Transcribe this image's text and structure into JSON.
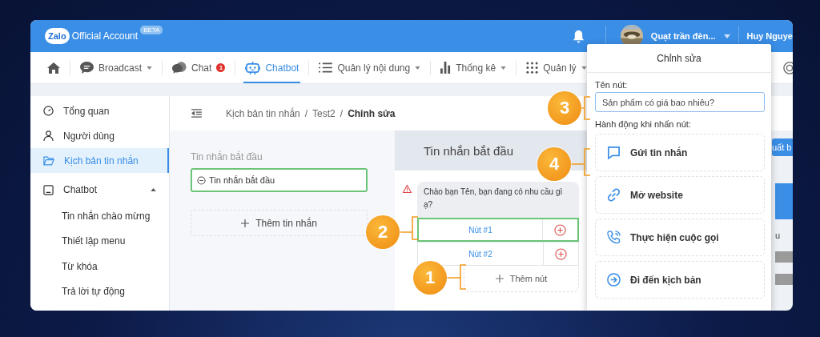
{
  "header": {
    "logo": "Zalo",
    "brand": "Official Account",
    "badge": "BETA",
    "page_name": "Quạt trần đèn...",
    "user_name": "Huy Nguye"
  },
  "nav": [
    {
      "kind": "home",
      "selected": false,
      "dropdown": false
    },
    {
      "kind": "broadcast",
      "label": "Broadcast",
      "selected": false,
      "dropdown": true
    },
    {
      "kind": "chat",
      "label": "Chat",
      "count": "1",
      "selected": false,
      "dropdown": false
    },
    {
      "kind": "chatbot",
      "label": "Chatbot",
      "selected": true,
      "dropdown": false
    },
    {
      "kind": "content",
      "label": "Quản lý nội dung",
      "selected": false,
      "dropdown": true
    },
    {
      "kind": "stats",
      "label": "Thống kê",
      "selected": false,
      "dropdown": true
    },
    {
      "kind": "manage",
      "label": "Quản lý",
      "selected": false,
      "dropdown": true
    }
  ],
  "sidebar": [
    {
      "kind": "gauge",
      "label": "Tổng quan",
      "selected": false
    },
    {
      "kind": "user",
      "label": "Người dùng",
      "selected": false
    },
    {
      "kind": "folder",
      "label": "Kịch bản tin nhắn",
      "selected": true
    },
    {
      "kind": "bot",
      "label": "Chatbot",
      "selected": false,
      "expanded": true,
      "children": [
        {
          "label": "Tin nhắn chào mừng",
          "selected": false
        },
        {
          "label": "Thiết lập menu",
          "selected": false
        },
        {
          "label": "Từ khóa",
          "selected": false
        },
        {
          "label": "Trả lời tự động",
          "selected": false
        }
      ]
    }
  ],
  "breadcrumb": [
    {
      "kind": "link",
      "label": "Kịch bản tin nhắn"
    },
    {
      "kind": "separator",
      "label": "/"
    },
    {
      "kind": "link",
      "label": "Test2"
    },
    {
      "kind": "separator",
      "label": "/"
    },
    {
      "kind": "current",
      "label": "Chỉnh sửa"
    }
  ],
  "messages": {
    "title": "Tin nhắn bắt đầu",
    "items": [
      {
        "label": "Tin nhắn bắt đầu",
        "selected": true
      }
    ],
    "add_button": "Thêm tin nhắn"
  },
  "preview": {
    "title": "Tin nhắn bắt đầu",
    "warning": true,
    "text": "Chào bạn Tên, bạn đang có nhu cầu gì ạ?",
    "buttons": [
      {
        "label": "Nút #1",
        "selected": true
      },
      {
        "label": "Nút #2",
        "selected": false
      }
    ],
    "add_button": "Thêm nút"
  },
  "side_strip": {
    "button": "uất b",
    "text": "u"
  },
  "editor": {
    "title": "Chỉnh sửa",
    "name_label": "Tên nút:",
    "name_value": "Sản phẩm có giá bao nhiêu?",
    "actions_label": "Hành động khi nhấn nút:",
    "actions": [
      {
        "kind": "message",
        "label": "Gửi tin nhắn"
      },
      {
        "kind": "link",
        "label": "Mở website"
      },
      {
        "kind": "call",
        "label": "Thực hiện cuộc gọi"
      },
      {
        "kind": "goto",
        "label": "Đi đến kịch bản"
      }
    ]
  },
  "callouts": [
    {
      "number": "1"
    },
    {
      "number": "2"
    },
    {
      "number": "3"
    },
    {
      "number": "4"
    }
  ]
}
